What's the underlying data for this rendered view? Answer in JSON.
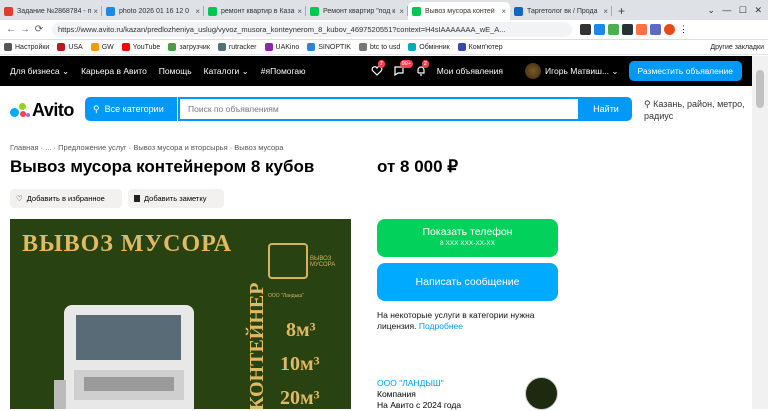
{
  "browser": {
    "tabs": [
      {
        "title": "Задание №2868784 - п",
        "color": "#e53935",
        "active": false
      },
      {
        "title": "photo 2026 01 16 12 0",
        "color": "#1e88e5",
        "active": false
      },
      {
        "title": "ремонт квартир в Каза",
        "color": "#00c853",
        "active": false
      },
      {
        "title": "Ремонт квартир \"под к",
        "color": "#00c853",
        "active": false
      },
      {
        "title": "Вывоз мусора контей",
        "color": "#00c853",
        "active": true
      },
      {
        "title": "Таргетолог вк / Прода",
        "color": "#1565c0",
        "active": false
      }
    ],
    "url": "https://www.avito.ru/kazan/predlozheniya_uslug/vyvoz_musora_konteynerom_8_kubov_4697520551?context=H4sIAAAAAAA_wE_A...",
    "bookmarks": [
      {
        "label": "Настройки",
        "color": "#555"
      },
      {
        "label": "USA",
        "color": "#b71c1c"
      },
      {
        "label": "GW",
        "color": "#ff9800"
      },
      {
        "label": "YouTube",
        "color": "#f00"
      },
      {
        "label": "загрузчик",
        "color": "#43a047"
      },
      {
        "label": "rutracker",
        "color": "#546e7a"
      },
      {
        "label": "UAKino",
        "color": "#8e24aa"
      },
      {
        "label": "SINOPTIK",
        "color": "#1e88e5"
      },
      {
        "label": "btc to usd",
        "color": "#777"
      },
      {
        "label": "Обмінник",
        "color": "#00acc1"
      },
      {
        "label": "Комп'ютер",
        "color": "#3949ab"
      }
    ],
    "other_bookmarks": "Другие закладки"
  },
  "topnav": {
    "items": [
      "Для бизнеса ⌄",
      "Карьера в Авито",
      "Помощь",
      "Каталоги ⌄",
      "#яПомогаю"
    ],
    "badges": [
      "7",
      "99+",
      "2"
    ],
    "my_ads": "Мои объявления",
    "user": "Игорь Матвиш... ⌄",
    "post_button": "Разместить объявление"
  },
  "header": {
    "logo": "Avito",
    "categories": "Все категории",
    "search_placeholder": "Поиск по объявлениям",
    "find": "Найти",
    "location": "Казань, район, метро, радиус"
  },
  "listing": {
    "breadcrumbs": "Главная  ·  ...  ·  Предложение услуг  ·  Вывоз мусора и вторсырья  ·  Вывоз мусора",
    "title": "Вывоз мусора контейнером 8 кубов",
    "price": "от 8 000 ₽",
    "favorite": "Добавить в избранное",
    "note": "Добавить заметку",
    "photo": {
      "headline": "ВЫВОЗ МУСОРА",
      "brand": "ВЫВОЗ МУСОРА",
      "company_line": "ООО \"Ландыш\"",
      "vertical": "КОНТЕЙНЕР",
      "volumes": [
        "8м³",
        "10м³",
        "20м³"
      ]
    },
    "show_phone": "Показать телефон",
    "phone_mask": "8 XXX XXX-XX-XX",
    "write_message": "Написать сообщение",
    "license_note": "На некоторые услуги в категории нужна лицензия.",
    "license_link": "Подробнее",
    "seller_name": "ООО \"ЛАНДЫШ\"",
    "seller_type": "Компания",
    "seller_since": "На Авито с 2024 года"
  }
}
